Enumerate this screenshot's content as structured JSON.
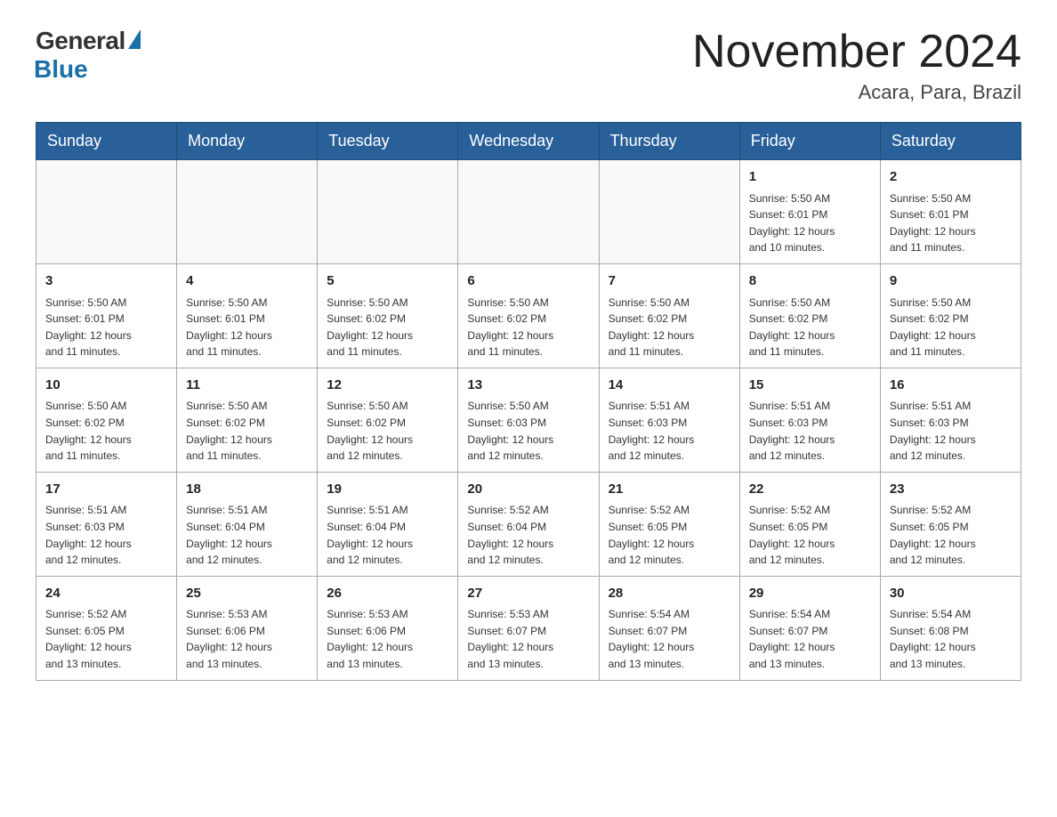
{
  "logo": {
    "general": "General",
    "blue": "Blue"
  },
  "title": {
    "month_year": "November 2024",
    "location": "Acara, Para, Brazil"
  },
  "weekdays": [
    "Sunday",
    "Monday",
    "Tuesday",
    "Wednesday",
    "Thursday",
    "Friday",
    "Saturday"
  ],
  "weeks": [
    [
      {
        "day": "",
        "info": ""
      },
      {
        "day": "",
        "info": ""
      },
      {
        "day": "",
        "info": ""
      },
      {
        "day": "",
        "info": ""
      },
      {
        "day": "",
        "info": ""
      },
      {
        "day": "1",
        "info": "Sunrise: 5:50 AM\nSunset: 6:01 PM\nDaylight: 12 hours\nand 10 minutes."
      },
      {
        "day": "2",
        "info": "Sunrise: 5:50 AM\nSunset: 6:01 PM\nDaylight: 12 hours\nand 11 minutes."
      }
    ],
    [
      {
        "day": "3",
        "info": "Sunrise: 5:50 AM\nSunset: 6:01 PM\nDaylight: 12 hours\nand 11 minutes."
      },
      {
        "day": "4",
        "info": "Sunrise: 5:50 AM\nSunset: 6:01 PM\nDaylight: 12 hours\nand 11 minutes."
      },
      {
        "day": "5",
        "info": "Sunrise: 5:50 AM\nSunset: 6:02 PM\nDaylight: 12 hours\nand 11 minutes."
      },
      {
        "day": "6",
        "info": "Sunrise: 5:50 AM\nSunset: 6:02 PM\nDaylight: 12 hours\nand 11 minutes."
      },
      {
        "day": "7",
        "info": "Sunrise: 5:50 AM\nSunset: 6:02 PM\nDaylight: 12 hours\nand 11 minutes."
      },
      {
        "day": "8",
        "info": "Sunrise: 5:50 AM\nSunset: 6:02 PM\nDaylight: 12 hours\nand 11 minutes."
      },
      {
        "day": "9",
        "info": "Sunrise: 5:50 AM\nSunset: 6:02 PM\nDaylight: 12 hours\nand 11 minutes."
      }
    ],
    [
      {
        "day": "10",
        "info": "Sunrise: 5:50 AM\nSunset: 6:02 PM\nDaylight: 12 hours\nand 11 minutes."
      },
      {
        "day": "11",
        "info": "Sunrise: 5:50 AM\nSunset: 6:02 PM\nDaylight: 12 hours\nand 11 minutes."
      },
      {
        "day": "12",
        "info": "Sunrise: 5:50 AM\nSunset: 6:02 PM\nDaylight: 12 hours\nand 12 minutes."
      },
      {
        "day": "13",
        "info": "Sunrise: 5:50 AM\nSunset: 6:03 PM\nDaylight: 12 hours\nand 12 minutes."
      },
      {
        "day": "14",
        "info": "Sunrise: 5:51 AM\nSunset: 6:03 PM\nDaylight: 12 hours\nand 12 minutes."
      },
      {
        "day": "15",
        "info": "Sunrise: 5:51 AM\nSunset: 6:03 PM\nDaylight: 12 hours\nand 12 minutes."
      },
      {
        "day": "16",
        "info": "Sunrise: 5:51 AM\nSunset: 6:03 PM\nDaylight: 12 hours\nand 12 minutes."
      }
    ],
    [
      {
        "day": "17",
        "info": "Sunrise: 5:51 AM\nSunset: 6:03 PM\nDaylight: 12 hours\nand 12 minutes."
      },
      {
        "day": "18",
        "info": "Sunrise: 5:51 AM\nSunset: 6:04 PM\nDaylight: 12 hours\nand 12 minutes."
      },
      {
        "day": "19",
        "info": "Sunrise: 5:51 AM\nSunset: 6:04 PM\nDaylight: 12 hours\nand 12 minutes."
      },
      {
        "day": "20",
        "info": "Sunrise: 5:52 AM\nSunset: 6:04 PM\nDaylight: 12 hours\nand 12 minutes."
      },
      {
        "day": "21",
        "info": "Sunrise: 5:52 AM\nSunset: 6:05 PM\nDaylight: 12 hours\nand 12 minutes."
      },
      {
        "day": "22",
        "info": "Sunrise: 5:52 AM\nSunset: 6:05 PM\nDaylight: 12 hours\nand 12 minutes."
      },
      {
        "day": "23",
        "info": "Sunrise: 5:52 AM\nSunset: 6:05 PM\nDaylight: 12 hours\nand 12 minutes."
      }
    ],
    [
      {
        "day": "24",
        "info": "Sunrise: 5:52 AM\nSunset: 6:05 PM\nDaylight: 12 hours\nand 13 minutes."
      },
      {
        "day": "25",
        "info": "Sunrise: 5:53 AM\nSunset: 6:06 PM\nDaylight: 12 hours\nand 13 minutes."
      },
      {
        "day": "26",
        "info": "Sunrise: 5:53 AM\nSunset: 6:06 PM\nDaylight: 12 hours\nand 13 minutes."
      },
      {
        "day": "27",
        "info": "Sunrise: 5:53 AM\nSunset: 6:07 PM\nDaylight: 12 hours\nand 13 minutes."
      },
      {
        "day": "28",
        "info": "Sunrise: 5:54 AM\nSunset: 6:07 PM\nDaylight: 12 hours\nand 13 minutes."
      },
      {
        "day": "29",
        "info": "Sunrise: 5:54 AM\nSunset: 6:07 PM\nDaylight: 12 hours\nand 13 minutes."
      },
      {
        "day": "30",
        "info": "Sunrise: 5:54 AM\nSunset: 6:08 PM\nDaylight: 12 hours\nand 13 minutes."
      }
    ]
  ]
}
